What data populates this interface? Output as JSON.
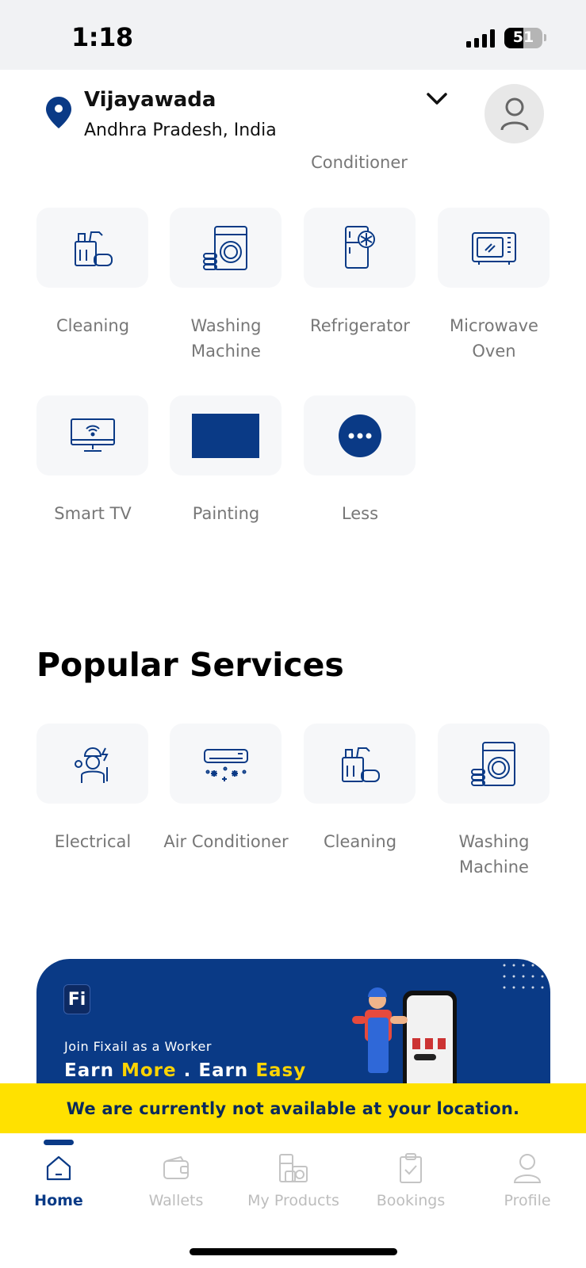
{
  "status_bar": {
    "time": "1:18",
    "battery": "51"
  },
  "header": {
    "city": "Vijayawada",
    "region": "Andhra Pradesh, India"
  },
  "partial_row_label": "Conditioner",
  "categories": [
    {
      "label": "Cleaning",
      "icon": "cleaning-icon"
    },
    {
      "label": "Washing Machine",
      "icon": "washing-machine-icon"
    },
    {
      "label": "Refrigerator",
      "icon": "refrigerator-icon"
    },
    {
      "label": "Microwave Oven",
      "icon": "microwave-icon"
    },
    {
      "label": "Smart TV",
      "icon": "smart-tv-icon"
    },
    {
      "label": "Painting",
      "icon": "painting-icon"
    },
    {
      "label": "Less",
      "icon": "more-dots-icon"
    }
  ],
  "popular": {
    "title": "Popular Services",
    "items": [
      {
        "label": "Electrical",
        "icon": "electrician-icon"
      },
      {
        "label": "Air Conditioner",
        "icon": "air-conditioner-icon"
      },
      {
        "label": "Cleaning",
        "icon": "cleaning-icon"
      },
      {
        "label": "Washing Machine",
        "icon": "washing-machine-icon"
      }
    ]
  },
  "banner": {
    "logo": "Fi",
    "subtitle": "Join Fixail as a Worker",
    "headline_a": "Earn ",
    "headline_b": "More",
    "headline_c": " . Earn ",
    "headline_d": "Easy"
  },
  "alert": "We are currently not available at your location.",
  "tabs": [
    {
      "label": "Home",
      "icon": "home-icon",
      "active": true
    },
    {
      "label": "Wallets",
      "icon": "wallet-icon",
      "active": false
    },
    {
      "label": "My Products",
      "icon": "products-icon",
      "active": false
    },
    {
      "label": "Bookings",
      "icon": "clipboard-icon",
      "active": false
    },
    {
      "label": "Profile",
      "icon": "profile-icon",
      "active": false
    }
  ],
  "colors": {
    "brand": "#0a3a86",
    "accent": "#ffd400",
    "alert_bg": "#ffe100"
  }
}
